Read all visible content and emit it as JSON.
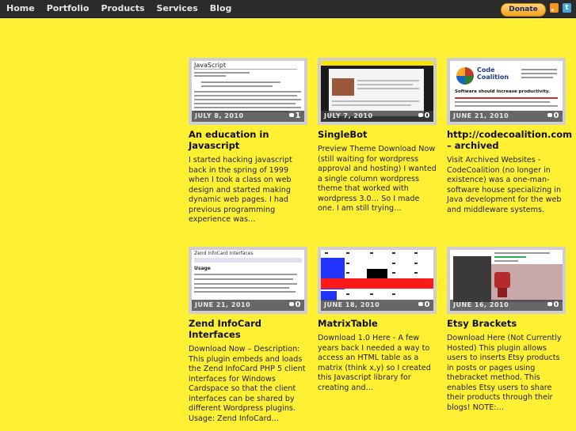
{
  "nav": {
    "items": [
      "Home",
      "Portfolio",
      "Products",
      "Services",
      "Blog"
    ],
    "donate_label": "Donate",
    "twitter_glyph": "t"
  },
  "icons": [
    "rss-icon",
    "twitter-icon",
    "comment-bubble-icon"
  ],
  "colors": {
    "background": "#fff034",
    "topbar": "#2b2b2b"
  },
  "thumb_texts": {
    "javascript_heading": "JavaScript",
    "code_coalition_logo": "Code Coalition",
    "code_coalition_tagline": "Software should increase productivity.",
    "zend_heading": "Zend InfoCard Interfaces",
    "zend_usage": "Usage"
  },
  "posts": [
    {
      "date": "JULY 8, 2010",
      "comments": "1",
      "title": "An education in Javascript",
      "excerpt": "I started hacking javascript back in the spring of 1999 when I took a class on web design and started making dynamic web pages.  I had previous programming experience was…"
    },
    {
      "date": "JULY 7, 2010",
      "comments": "0",
      "title": "SingleBot",
      "excerpt": "Preview Theme Download Now (still waiting for wordpress approval and hosting) I wanted a single column wordpress theme that worked with wordpress 3.0… So I made one.  I am still trying…"
    },
    {
      "date": "JUNE 21, 2010",
      "comments": "0",
      "title": "http://codecoalition.com – archived",
      "excerpt": "Visit Archived Websites - CodeCoalition (no longer in existence) was a one-man-software house specializing in Java development for the web and middleware systems."
    },
    {
      "date": "JUNE 21, 2010",
      "comments": "0",
      "title": "Zend InfoCard Interfaces",
      "excerpt": "Download Now – Description: This plugin embeds and loads the Zend InfoCard PHP 5 client interfaces for Windows Cardspace so that the client interfaces can be shared by different Wordpress plugins. Usage: Zend InfoCard…"
    },
    {
      "date": "JUNE 18, 2010",
      "comments": "0",
      "title": "MatrixTable",
      "excerpt": "Download 1.0 Here - A few years back I needed a way to access an HTML table as a matrix (think x,y) so I created this Javascript library for creating and…"
    },
    {
      "date": "JUNE 16, 2010",
      "comments": "0",
      "title": "Etsy Brackets",
      "excerpt": "Download Here (Not Currently Hosted) This plugin allows users to inserts Etsy products in posts or pages using thebracket method. This enables Etsy users to share their products through their blogs! NOTE:…"
    }
  ]
}
